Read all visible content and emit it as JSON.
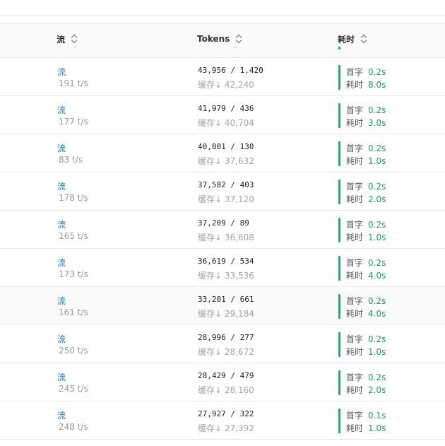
{
  "header": {
    "stream_label": "流",
    "tokens_label": "Tokens",
    "time_label": "耗时"
  },
  "labels": {
    "stream": "流",
    "cache_prefix": "缓存",
    "cache_arrow": "↓",
    "first_token": "首字",
    "duration": "耗时"
  },
  "rows": [
    {
      "stream": "流",
      "rate": "191 t/s",
      "tokens": "43,956 / 1,420",
      "cache": "42,240",
      "first": "0.2s",
      "total": "8.0s",
      "shaded": false
    },
    {
      "stream": "流",
      "rate": "177 t/s",
      "tokens": "41,979 / 436",
      "cache": "40,704",
      "first": "0.2s",
      "total": "3.0s",
      "shaded": false
    },
    {
      "stream": "流",
      "rate": "83 t/s",
      "tokens": "40,801 / 130",
      "cache": "37,632",
      "first": "0.2s",
      "total": "1.0s",
      "shaded": false
    },
    {
      "stream": "流",
      "rate": "178 t/s",
      "tokens": "37,582 / 403",
      "cache": "37,120",
      "first": "0.2s",
      "total": "2.0s",
      "shaded": false
    },
    {
      "stream": "流",
      "rate": "165 t/s",
      "tokens": "37,209 / 89",
      "cache": "36,608",
      "first": "0.2s",
      "total": "1.0s",
      "shaded": false
    },
    {
      "stream": "流",
      "rate": "173 t/s",
      "tokens": "36,619 / 534",
      "cache": "33,536",
      "first": "0.2s",
      "total": "4.0s",
      "shaded": false
    },
    {
      "stream": "流",
      "rate": "161 t/s",
      "tokens": "33,201 / 661",
      "cache": "29,184",
      "first": "0.2s",
      "total": "4.0s",
      "shaded": true
    },
    {
      "stream": "流",
      "rate": "250 t/s",
      "tokens": "28,996 / 277",
      "cache": "28,672",
      "first": "0.2s",
      "total": "1.0s",
      "shaded": false
    },
    {
      "stream": "流",
      "rate": "245 t/s",
      "tokens": "28,429 / 479",
      "cache": "28,160",
      "first": "0.2s",
      "total": "2.0s",
      "shaded": false
    },
    {
      "stream": "流",
      "rate": "248 t/s",
      "tokens": "27,927 / 322",
      "cache": "27,392",
      "first": "0.1s",
      "total": "1.0s",
      "shaded": false
    }
  ]
}
